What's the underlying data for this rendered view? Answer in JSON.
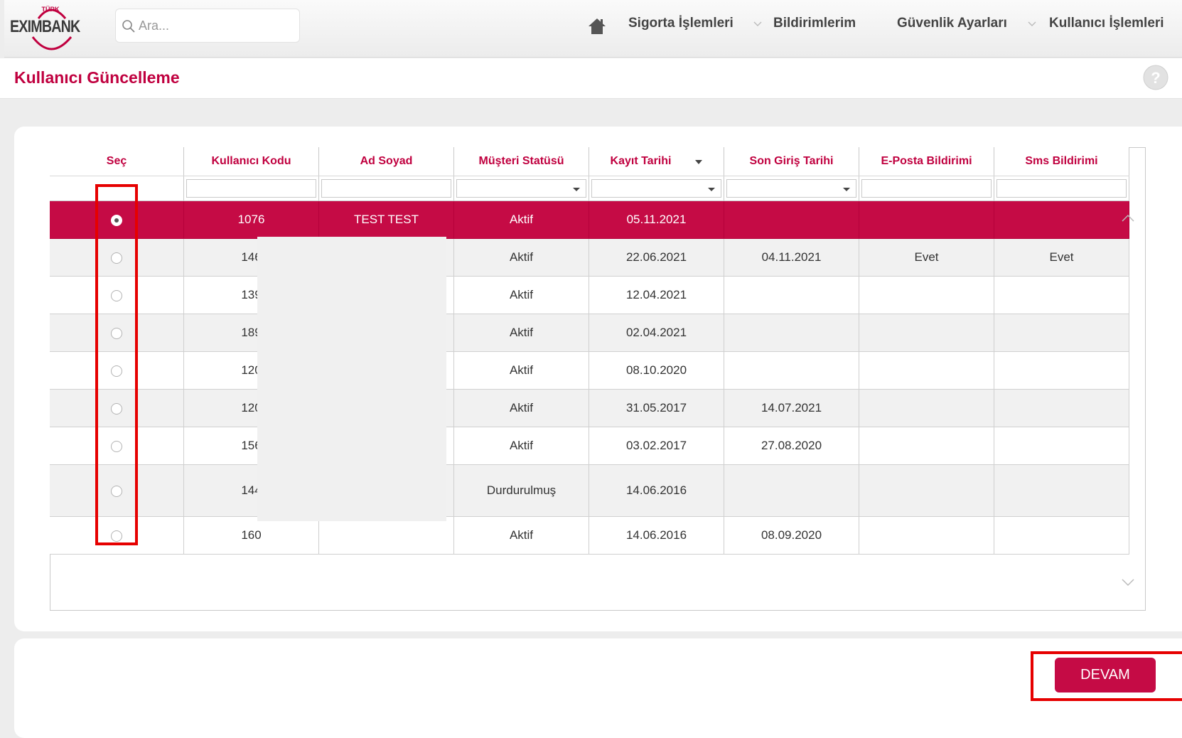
{
  "logo": {
    "turk": "TÜRK",
    "word": "EXIMBANK"
  },
  "search": {
    "placeholder": "Ara..."
  },
  "nav": {
    "items": [
      "Sigorta İşlemleri",
      "Bildirimlerim",
      "Güvenlik Ayarları",
      "Kullanıcı İşlemleri"
    ],
    "icons": {
      "home": "home-icon",
      "dropdown": "chevron-down-icon"
    }
  },
  "page": {
    "title": "Kullanıcı Güncelleme"
  },
  "table": {
    "columns": [
      "Seç",
      "Kullanıcı Kodu",
      "Ad Soyad",
      "Müşteri Statüsü",
      "Kayıt Tarihi",
      "Son Giriş Tarihi",
      "E-Posta Bildirimi",
      "Sms Bildirimi"
    ],
    "rows": [
      {
        "selected": true,
        "kod": "1076",
        "ad": "TEST TEST",
        "statu": "Aktif",
        "kayit": "05.11.2021",
        "son": "",
        "eposta": "",
        "sms": ""
      },
      {
        "selected": false,
        "kod": "146",
        "ad": "",
        "statu": "Aktif",
        "kayit": "22.06.2021",
        "son": "04.11.2021",
        "eposta": "Evet",
        "sms": "Evet"
      },
      {
        "selected": false,
        "kod": "139",
        "ad": "",
        "statu": "Aktif",
        "kayit": "12.04.2021",
        "son": "",
        "eposta": "",
        "sms": ""
      },
      {
        "selected": false,
        "kod": "189",
        "ad": "",
        "statu": "Aktif",
        "kayit": "02.04.2021",
        "son": "",
        "eposta": "",
        "sms": ""
      },
      {
        "selected": false,
        "kod": "120",
        "ad": "",
        "statu": "Aktif",
        "kayit": "08.10.2020",
        "son": "",
        "eposta": "",
        "sms": ""
      },
      {
        "selected": false,
        "kod": "120",
        "ad": "",
        "statu": "Aktif",
        "kayit": "31.05.2017",
        "son": "14.07.2021",
        "eposta": "",
        "sms": ""
      },
      {
        "selected": false,
        "kod": "156",
        "ad": "",
        "statu": "Aktif",
        "kayit": "03.02.2017",
        "son": "27.08.2020",
        "eposta": "",
        "sms": ""
      },
      {
        "selected": false,
        "kod": "144",
        "ad": "",
        "statu": "Durdurulmuş",
        "kayit": "14.06.2016",
        "son": "",
        "eposta": "",
        "sms": ""
      },
      {
        "selected": false,
        "kod": "160",
        "ad": "",
        "statu": "Aktif",
        "kayit": "14.06.2016",
        "son": "08.09.2020",
        "eposta": "",
        "sms": ""
      }
    ]
  },
  "actions": {
    "continue_label": "DEVAM"
  },
  "colors": {
    "brand": "#c50b45",
    "title": "#c0003f",
    "highlight": "#e60000"
  }
}
